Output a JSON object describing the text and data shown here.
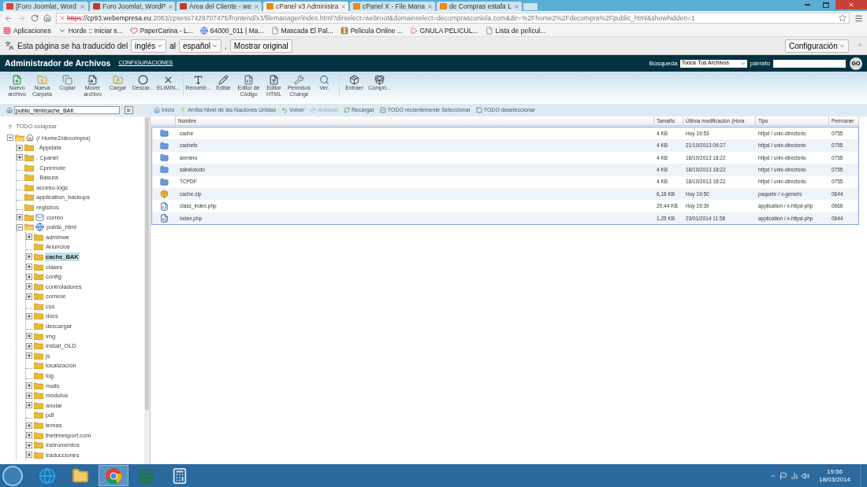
{
  "browser": {
    "tabs": [
      {
        "kind": "mail",
        "title": "[Foro Joomla!, Word",
        "selected": false
      },
      {
        "kind": "w",
        "title": "Foro Joomla!, WordP",
        "selected": false
      },
      {
        "kind": "w",
        "title": "Área del Cliente - we",
        "selected": false
      },
      {
        "kind": "cp",
        "title": "cPanel v3 Administra",
        "selected": true
      },
      {
        "kind": "cp",
        "title": "cPanel X - File Mana",
        "selected": false
      },
      {
        "kind": "cp",
        "title": "de Compras estafa L",
        "selected": false
      }
    ],
    "url": {
      "scheme": "https",
      "host": "://cp93.webempresa.eu",
      "path": ":2083/cpsess7429707475/frontend/x3/filemanager/index.html?dirselect=webroot&domainselect=decomprasconlola.com&dir=%2Fhome2%2Fdecompra%2Fpublic_html&showhidden=1"
    },
    "bookmarks": [
      {
        "kind": "apps",
        "label": "Aplicaciones"
      },
      {
        "kind": "horde",
        "label": "Horde :: Iniciar s..."
      },
      {
        "kind": "heart",
        "label": "PaperCarina - L..."
      },
      {
        "kind": "g",
        "label": "64000_011 | Ma..."
      },
      {
        "kind": "page",
        "label": "Mascada El Pal..."
      },
      {
        "kind": "film",
        "label": "Pelicula Online ..."
      },
      {
        "kind": "play",
        "label": "GNULA PELICUL..."
      },
      {
        "kind": "page",
        "label": "Lista de películ..."
      }
    ]
  },
  "translate_bar": {
    "text": "Esta página se ha traducido del",
    "from": "inglés",
    "to_label": "al",
    "to": "español",
    "dot": ".",
    "show_original": "Mostrar original",
    "settings": "Configuración",
    "close": "×"
  },
  "header": {
    "title": "Administrador de Archivos",
    "settings_link": "CONFIGURACIONES",
    "search_label": "Búsqueda",
    "search_scope": "Todos Tus Archivos",
    "text_label": "párrafo",
    "go": "GO"
  },
  "toolbar": [
    [
      "Nuevo archivo",
      "Nueva Carpeta",
      "Copiar",
      "Mover archivo",
      "Cargar",
      "Descar...",
      "ELIMIN..."
    ],
    [
      "Renomb...",
      "Editar",
      "Editor de Código",
      "Editor HTML",
      "Permisos Change",
      "Ver."
    ],
    [
      "Extraer",
      "Compri..."
    ]
  ],
  "path_bar": {
    "value": "public_html/cache_BAK",
    "go": "Ir"
  },
  "nav": [
    {
      "label": "Inicio",
      "disabled": false
    },
    {
      "label": "Arriba Nivel de las Naciones Unidas",
      "disabled": false
    },
    {
      "label": "Volver",
      "disabled": false
    },
    {
      "label": "Avanzar",
      "disabled": true
    },
    {
      "label": "Recargar",
      "disabled": false
    },
    {
      "label": "TODO recientemente Seleccionar",
      "disabled": false
    },
    {
      "label": "TODO deseleccionar",
      "disabled": false
    }
  ],
  "tree": {
    "collapse_all": "TODO colapsar",
    "items": [
      {
        "label": "(/ Home2/decompra)",
        "kind": "home",
        "has_children": true,
        "expanded": true,
        "selected": false,
        "children": [
          {
            "label": ". Appdata",
            "kind": "folder",
            "has_children": true,
            "expanded": false,
            "selected": false
          },
          {
            "label": ". Cpanel",
            "kind": "folder",
            "has_children": true,
            "expanded": false,
            "selected": false
          },
          {
            "label": ". Cpremote",
            "kind": "folder",
            "has_children": false,
            "expanded": false,
            "selected": false
          },
          {
            "label": ". Basura",
            "kind": "folder",
            "has_children": false,
            "expanded": false,
            "selected": false
          },
          {
            "label": "acceso-logs",
            "kind": "folder",
            "has_children": false,
            "expanded": false,
            "selected": false
          },
          {
            "label": "application_backups",
            "kind": "folder",
            "has_children": false,
            "expanded": false,
            "selected": false
          },
          {
            "label": "registros",
            "kind": "folder",
            "has_children": false,
            "expanded": false,
            "selected": false
          },
          {
            "label": "correo",
            "kind": "mail",
            "has_children": true,
            "expanded": false,
            "selected": false
          },
          {
            "label": "public_html",
            "kind": "web",
            "has_children": true,
            "expanded": true,
            "selected": false,
            "children": [
              {
                "label": "adminwe",
                "kind": "folder",
                "has_children": true,
                "expanded": false,
                "selected": false
              },
              {
                "label": "Anuncios",
                "kind": "folder",
                "has_children": false,
                "expanded": false,
                "selected": false
              },
              {
                "label": "cache_BAK",
                "kind": "folder",
                "has_children": true,
                "expanded": false,
                "selected": true
              },
              {
                "label": "clases",
                "kind": "folder",
                "has_children": true,
                "expanded": false,
                "selected": false
              },
              {
                "label": "config",
                "kind": "folder",
                "has_children": true,
                "expanded": false,
                "selected": false
              },
              {
                "label": "controladores",
                "kind": "folder",
                "has_children": true,
                "expanded": false,
                "selected": false
              },
              {
                "label": "correoe",
                "kind": "folder",
                "has_children": true,
                "expanded": false,
                "selected": false
              },
              {
                "label": "css",
                "kind": "folder",
                "has_children": false,
                "expanded": false,
                "selected": false
              },
              {
                "label": "docs",
                "kind": "folder",
                "has_children": true,
                "expanded": false,
                "selected": false
              },
              {
                "label": "descargar",
                "kind": "folder",
                "has_children": false,
                "expanded": false,
                "selected": false
              },
              {
                "label": "img",
                "kind": "folder",
                "has_children": true,
                "expanded": false,
                "selected": false
              },
              {
                "label": "install_OLD",
                "kind": "folder",
                "has_children": true,
                "expanded": false,
                "selected": false
              },
              {
                "label": "js",
                "kind": "folder",
                "has_children": true,
                "expanded": false,
                "selected": false
              },
              {
                "label": "localización",
                "kind": "folder",
                "has_children": false,
                "expanded": false,
                "selected": false
              },
              {
                "label": "log",
                "kind": "folder",
                "has_children": false,
                "expanded": false,
                "selected": false
              },
              {
                "label": "mails",
                "kind": "folder",
                "has_children": true,
                "expanded": false,
                "selected": false
              },
              {
                "label": "módulos",
                "kind": "folder",
                "has_children": true,
                "expanded": false,
                "selected": false
              },
              {
                "label": "anular",
                "kind": "folder",
                "has_children": true,
                "expanded": false,
                "selected": false
              },
              {
                "label": "pdf",
                "kind": "folder",
                "has_children": false,
                "expanded": false,
                "selected": false
              },
              {
                "label": "temas",
                "kind": "folder",
                "has_children": true,
                "expanded": false,
                "selected": false
              },
              {
                "label": "thetimesport.com",
                "kind": "folder",
                "has_children": true,
                "expanded": false,
                "selected": false
              },
              {
                "label": "instrumentos",
                "kind": "folder",
                "has_children": true,
                "expanded": false,
                "selected": false
              },
              {
                "label": "traducciones",
                "kind": "folder",
                "has_children": true,
                "expanded": false,
                "selected": false
              }
            ]
          }
        ]
      }
    ]
  },
  "table": {
    "columns": [
      "Nombre",
      "Tamaño",
      "Última modificación (Hora",
      "Tipo",
      "Permaner"
    ],
    "rows": [
      {
        "kind": "folder",
        "name": "cache",
        "size": "4 KB",
        "modified": "Hoy 19:53",
        "type": "httpd / unix-directorio",
        "perms": "0755"
      },
      {
        "kind": "folder",
        "name": "cachefs",
        "size": "4 KB",
        "modified": "21/10/2013 09:27",
        "type": "httpd / unix-directorio",
        "perms": "0755"
      },
      {
        "kind": "folder",
        "name": "arenero",
        "size": "4 KB",
        "modified": "18/10/2013 18:22",
        "type": "httpd / unix-directorio",
        "perms": "0755"
      },
      {
        "kind": "folder",
        "name": "sabelotodo",
        "size": "4 KB",
        "modified": "18/10/2013 18:22",
        "type": "httpd / unix-directorio",
        "perms": "0755"
      },
      {
        "kind": "folder",
        "name": "TCPDF",
        "size": "4 KB",
        "modified": "18/10/2013 18:22",
        "type": "httpd / unix-directorio",
        "perms": "0755"
      },
      {
        "kind": "zip",
        "name": "cache.zip",
        "size": "6,18 KB",
        "modified": "Hoy 19:50",
        "type": "paquete / x-generic",
        "perms": "0644"
      },
      {
        "kind": "php",
        "name": "class_index.php",
        "size": "29,44 KB",
        "modified": "Hoy 19:39",
        "type": "application / x-httpd-php",
        "perms": "0666"
      },
      {
        "kind": "php",
        "name": "index.php",
        "size": "1,25 KB",
        "modified": "23/01/2014 11:58",
        "type": "application / x-httpd-php",
        "perms": "0644"
      }
    ]
  },
  "taskbar": {
    "items": [
      {
        "kind": "ie",
        "selected": false
      },
      {
        "kind": "explorer",
        "selected": false
      },
      {
        "kind": "chrome",
        "selected": true
      },
      {
        "kind": "sheet",
        "selected": false
      },
      {
        "kind": "calc",
        "selected": false
      }
    ],
    "time": "19:56",
    "date": "18/03/2014"
  }
}
